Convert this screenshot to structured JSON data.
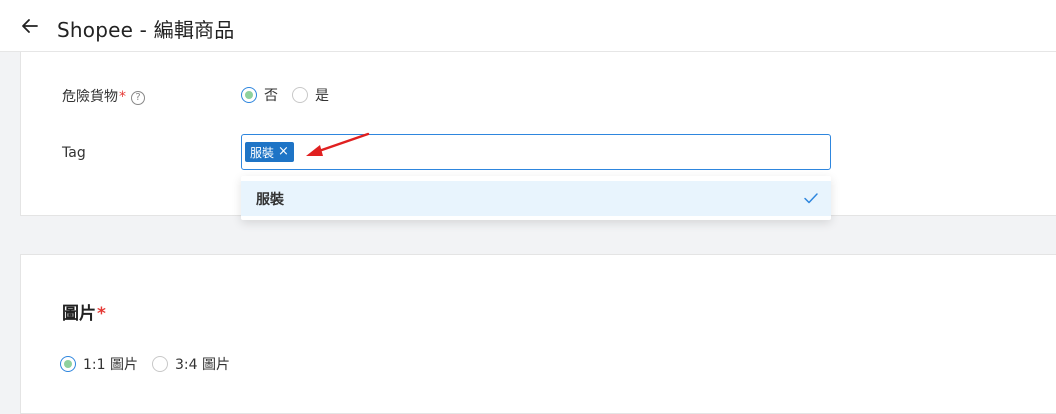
{
  "header": {
    "title": "Shopee - 編輯商品",
    "back_icon": "arrow-left-icon"
  },
  "form": {
    "dangerous_goods": {
      "label": "危險貨物",
      "required_mark": "*",
      "help_glyph": "?",
      "options": [
        {
          "label": "否",
          "selected": true
        },
        {
          "label": "是",
          "selected": false
        }
      ]
    },
    "tag": {
      "label": "Tag",
      "chips": [
        {
          "label": "服裝",
          "close": "×"
        }
      ],
      "dropdown": {
        "options": [
          {
            "label": "服裝",
            "selected": true
          }
        ]
      }
    }
  },
  "images_section": {
    "title": "圖片",
    "required_mark": "*",
    "ratio_options": [
      {
        "label": "1:1 圖片",
        "selected": true
      },
      {
        "label": "3:4 圖片",
        "selected": false
      }
    ]
  },
  "colors": {
    "accent": "#2e86de",
    "chip": "#1e74c6",
    "radio_fill": "#8fd19e",
    "required": "#e53935",
    "annotation": "#e02020",
    "dropdown_highlight": "#e8f4fd"
  }
}
